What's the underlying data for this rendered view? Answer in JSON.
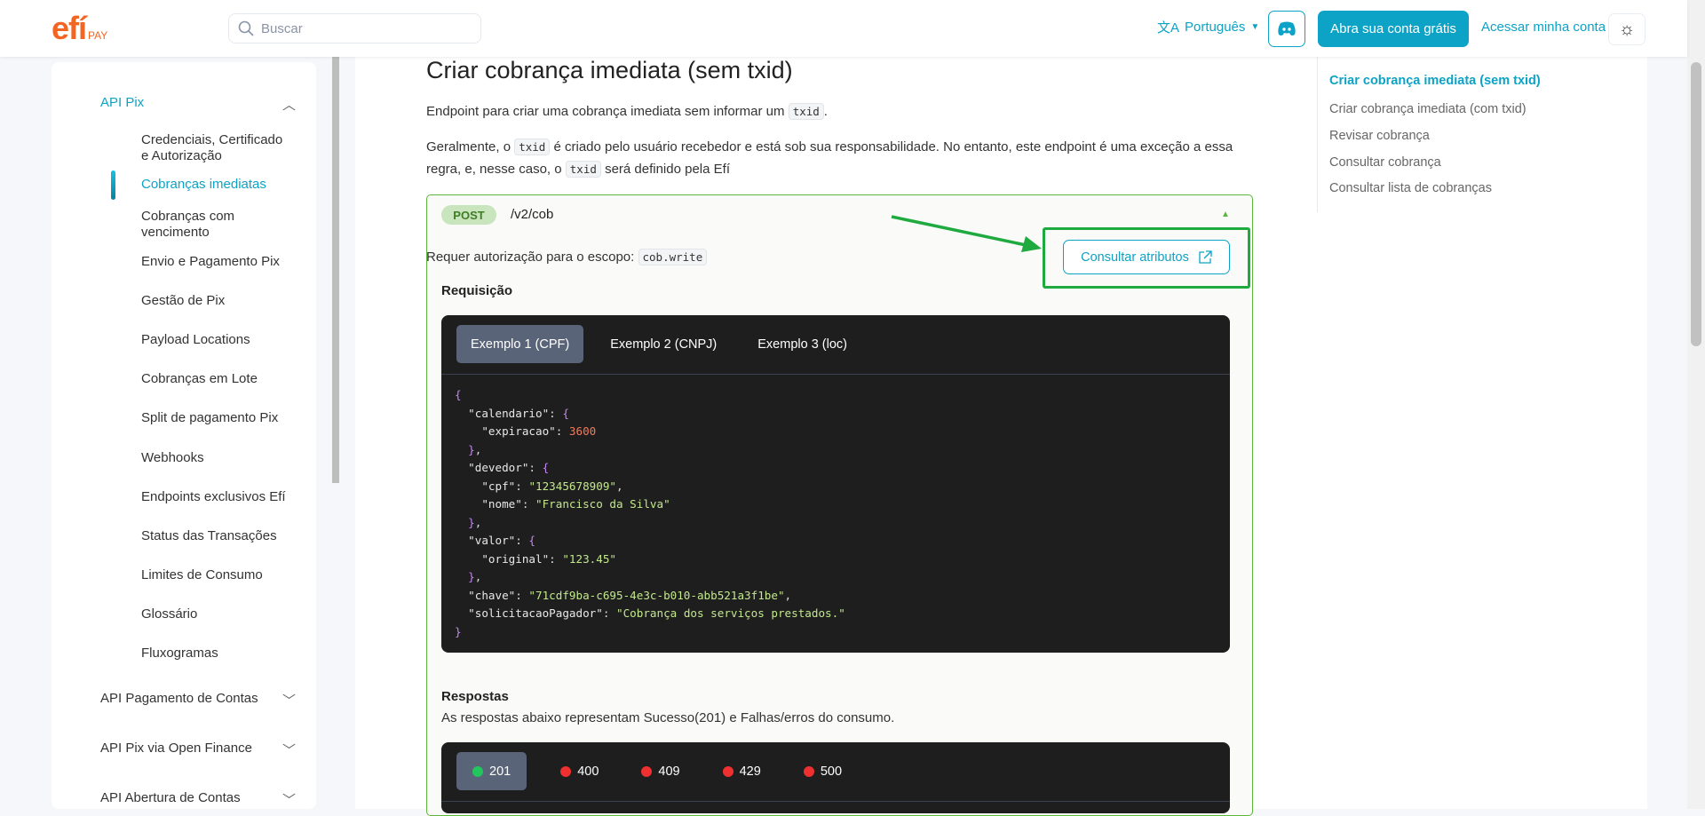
{
  "header": {
    "logo": "efí",
    "logo_sub": "PAY",
    "search_placeholder": "Buscar",
    "language": "Português",
    "cta": "Abra sua conta grátis",
    "login": "Acessar minha conta"
  },
  "sidebar": {
    "groups": [
      {
        "label": "API Pix",
        "expanded": true,
        "items": [
          "Credenciais, Certificado e Autorização",
          "Cobranças imediatas",
          "Cobranças com vencimento",
          "Envio e Pagamento Pix",
          "Gestão de Pix",
          "Payload Locations",
          "Cobranças em Lote",
          "Split de pagamento Pix",
          "Webhooks",
          "Endpoints exclusivos Efí",
          "Status das Transações",
          "Limites de Consumo",
          "Glossário",
          "Fluxogramas"
        ],
        "active": "Cobranças imediatas"
      },
      {
        "label": "API Pagamento de Contas"
      },
      {
        "label": "API Pix via Open Finance"
      },
      {
        "label": "API Abertura de Contas"
      }
    ]
  },
  "main": {
    "title": "Criar cobrança imediata (sem txid)",
    "p1_a": "Endpoint para criar uma cobrança imediata sem informar um",
    "p1_code": "txid",
    "p1_b": ".",
    "p2_a": "Geralmente, o",
    "p2_code1": "txid",
    "p2_b": "é criado pelo usuário recebedor e está sob sua responsabilidade. No entanto, este endpoint é uma exceção a essa regra, e,",
    "p2_c": "nesse caso, o",
    "p2_code2": "txid",
    "p2_d": "será definido pela Efí",
    "endpoint": {
      "method": "POST",
      "path": "/v2/cob",
      "scope_label": "Requer autorização para o escopo:",
      "scope": "cob.write",
      "attr_button": "Consultar atributos",
      "request_label": "Requisição",
      "examples": [
        "Exemplo 1 (CPF)",
        "Exemplo 2 (CNPJ)",
        "Exemplo 3 (loc)"
      ],
      "code": {
        "calendario_key": "\"calendario\"",
        "expiracao_key": "\"expiracao\"",
        "expiracao": "3600",
        "devedor_key": "\"devedor\"",
        "cpf_key": "\"cpf\"",
        "cpf": "\"12345678909\"",
        "nome_key": "\"nome\"",
        "nome": "\"Francisco da Silva\"",
        "valor_key": "\"valor\"",
        "original_key": "\"original\"",
        "original": "\"123.45\"",
        "chave_key": "\"chave\"",
        "chave": "\"71cdf9ba-c695-4e3c-b010-abb521a3f1be\"",
        "sol_key": "\"solicitacaoPagador\"",
        "sol": "\"Cobrança dos serviços prestados.\""
      },
      "responses_label": "Respostas",
      "responses_desc": "As respostas abaixo representam Sucesso(201) e Falhas/erros do consumo.",
      "status_tabs": [
        {
          "code": "201",
          "color": "#22c55e"
        },
        {
          "code": "400",
          "color": "#ef3030"
        },
        {
          "code": "409",
          "color": "#ef3030"
        },
        {
          "code": "429",
          "color": "#ef3030"
        },
        {
          "code": "500",
          "color": "#ef3030"
        }
      ]
    }
  },
  "toc": [
    "Criar cobrança imediata (sem txid)",
    "Criar cobrança imediata (com txid)",
    "Revisar cobrança",
    "Consultar cobrança",
    "Consultar lista de cobranças"
  ],
  "colors": {
    "accent": "#0ca3c6",
    "brand": "#f26522",
    "post": "#5db53b",
    "highlight": "#1faa3f"
  }
}
